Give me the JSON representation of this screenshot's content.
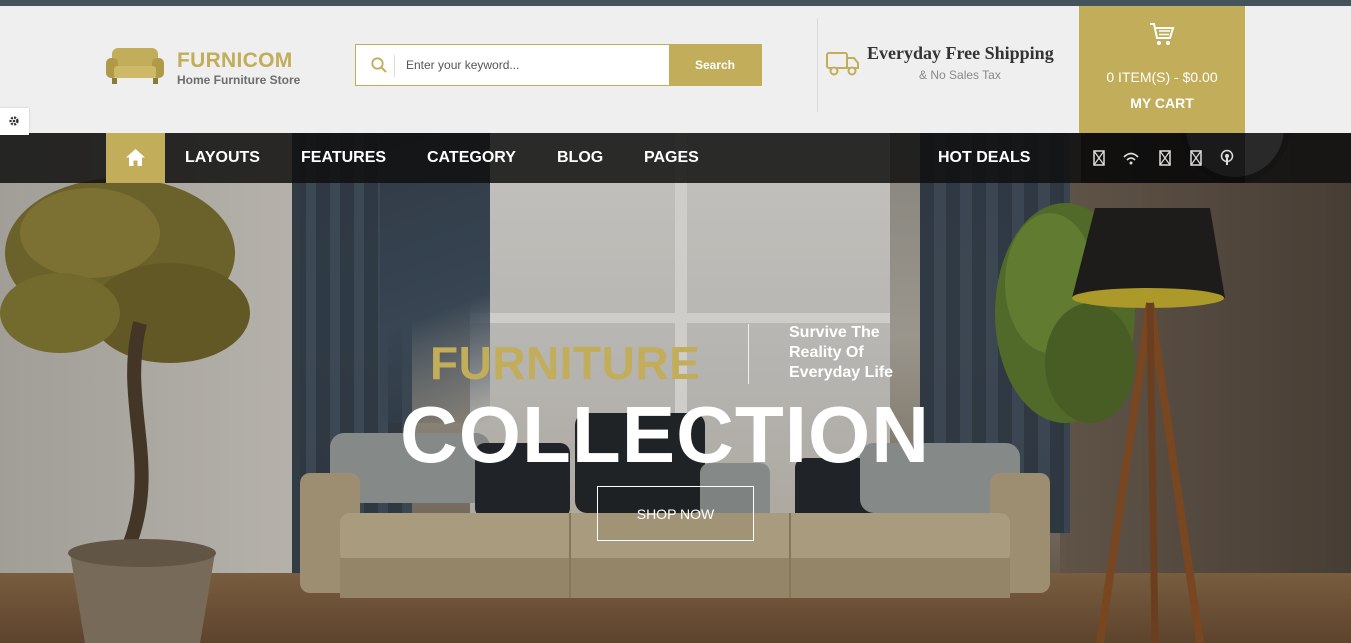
{
  "brand": {
    "name_part1": "FURNI",
    "name_part2": "COM",
    "tagline": "Home Furniture Store",
    "accent_color": "#c2ad5a",
    "logo_icon": "armchair-icon"
  },
  "search": {
    "placeholder": "Enter your keyword...",
    "button_label": "Search",
    "icon": "search-icon"
  },
  "shipping": {
    "title": "Everyday Free Shipping",
    "subtitle": "& No Sales Tax",
    "icon": "truck-icon"
  },
  "cart": {
    "count_text": "0 ITEM(S) - $0.00",
    "label": "MY CART",
    "icon": "cart-icon"
  },
  "settings": {
    "icon": "gear-icon"
  },
  "nav": {
    "home_icon": "home-icon",
    "items": [
      {
        "label": "LAYOUTS"
      },
      {
        "label": "FEATURES"
      },
      {
        "label": "CATEGORY"
      },
      {
        "label": "BLOG"
      },
      {
        "label": "PAGES"
      }
    ],
    "hot_deals": "HOT DEALS",
    "social_icons": [
      "placeholder-icon",
      "wifi-icon",
      "placeholder-icon",
      "placeholder-icon",
      "podcast-icon"
    ]
  },
  "hero": {
    "kicker": "FURNITURE",
    "tagline": [
      "Survive The",
      "Reality Of",
      "Everyday Life"
    ],
    "headline": "COLLECTION",
    "button_label": "SHOP NOW"
  }
}
